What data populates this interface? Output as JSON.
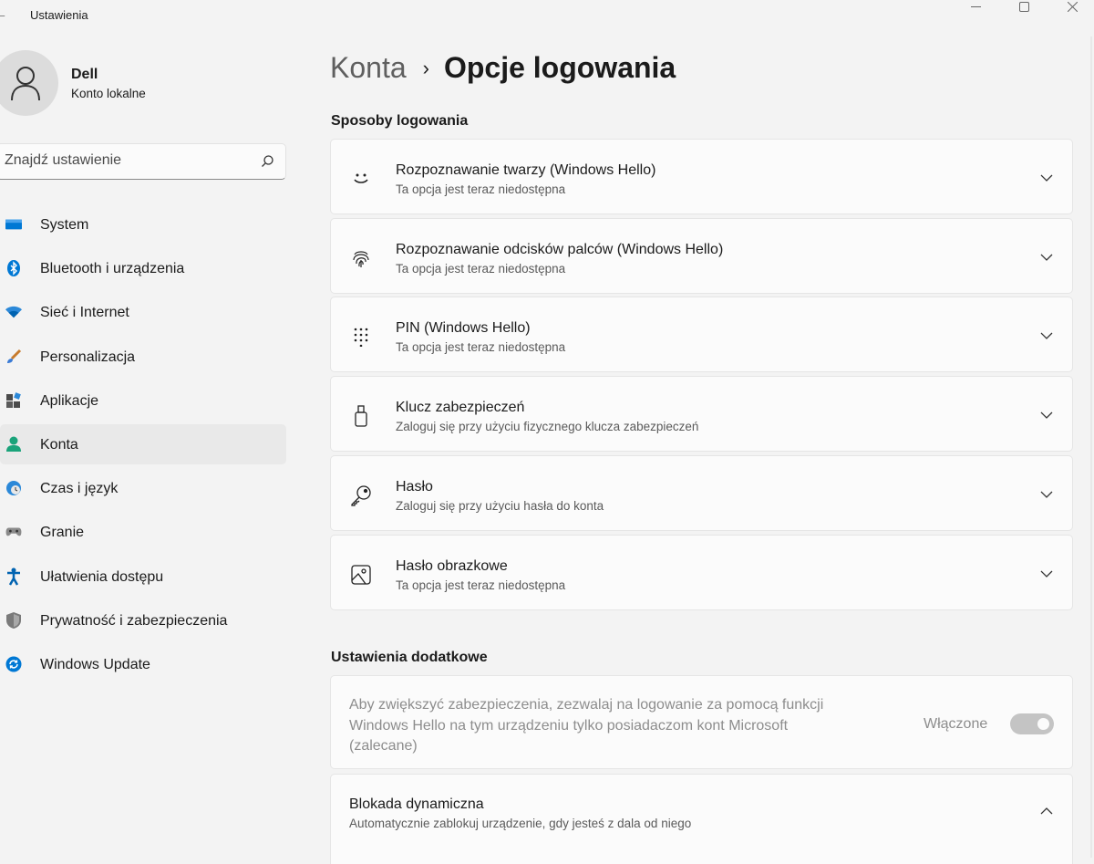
{
  "window": {
    "title": "Ustawienia",
    "back_icon": "arrow-left-icon",
    "controls": [
      "minimize-icon",
      "maximize-icon",
      "close-icon"
    ]
  },
  "user": {
    "name": "Dell",
    "account_type": "Konto lokalne"
  },
  "search": {
    "placeholder": "Znajdź ustawienie",
    "icon": "search-icon"
  },
  "nav": [
    {
      "label": "System",
      "icon": "system-icon",
      "active": false
    },
    {
      "label": "Bluetooth i urządzenia",
      "icon": "bluetooth-icon",
      "active": false
    },
    {
      "label": "Sieć i Internet",
      "icon": "wifi-icon",
      "active": false
    },
    {
      "label": "Personalizacja",
      "icon": "brush-icon",
      "active": false
    },
    {
      "label": "Aplikacje",
      "icon": "apps-icon",
      "active": false
    },
    {
      "label": "Konta",
      "icon": "accounts-icon",
      "active": true
    },
    {
      "label": "Czas i język",
      "icon": "time-language-icon",
      "active": false
    },
    {
      "label": "Granie",
      "icon": "gaming-icon",
      "active": false
    },
    {
      "label": "Ułatwienia dostępu",
      "icon": "accessibility-icon",
      "active": false
    },
    {
      "label": "Prywatność i zabezpieczenia",
      "icon": "shield-icon",
      "active": false
    },
    {
      "label": "Windows Update",
      "icon": "update-icon",
      "active": false
    }
  ],
  "breadcrumb": {
    "parent": "Konta",
    "separator": "›",
    "current": "Opcje logowania"
  },
  "signin": {
    "heading": "Sposoby logowania",
    "options": [
      {
        "title": "Rozpoznawanie twarzy (Windows Hello)",
        "desc": "Ta opcja jest teraz niedostępna",
        "icon": "face-icon"
      },
      {
        "title": "Rozpoznawanie odcisków palców (Windows Hello)",
        "desc": "Ta opcja jest teraz niedostępna",
        "icon": "fingerprint-icon"
      },
      {
        "title": "PIN (Windows Hello)",
        "desc": "Ta opcja jest teraz niedostępna",
        "icon": "pin-keypad-icon"
      },
      {
        "title": "Klucz zabezpieczeń",
        "desc": "Zaloguj się przy użyciu fizycznego klucza zabezpieczeń",
        "icon": "usb-key-icon"
      },
      {
        "title": "Hasło",
        "desc": "Zaloguj się przy użyciu hasła do konta",
        "icon": "key-icon"
      },
      {
        "title": "Hasło obrazkowe",
        "desc": "Ta opcja jest teraz niedostępna",
        "icon": "picture-icon"
      }
    ]
  },
  "extra": {
    "heading": "Ustawienia dodatkowe",
    "hello_only": {
      "text": "Aby zwiększyć zabezpieczenia, zezwalaj na logowanie za pomocą funkcji Windows Hello na tym urządzeniu tylko posiadaczom kont Microsoft (zalecane)",
      "toggle_label": "Włączone",
      "toggle_on": true,
      "disabled": true
    },
    "dynamic_lock": {
      "title": "Blokada dynamiczna",
      "desc": "Automatycznie zablokuj urządzenie, gdy jesteś z dala od niego",
      "expanded": true
    }
  },
  "colors": {
    "background": "#f3f3f3",
    "card": "#fbfbfb",
    "accent": "#0067c0",
    "active_nav": "#e9e9e9"
  }
}
